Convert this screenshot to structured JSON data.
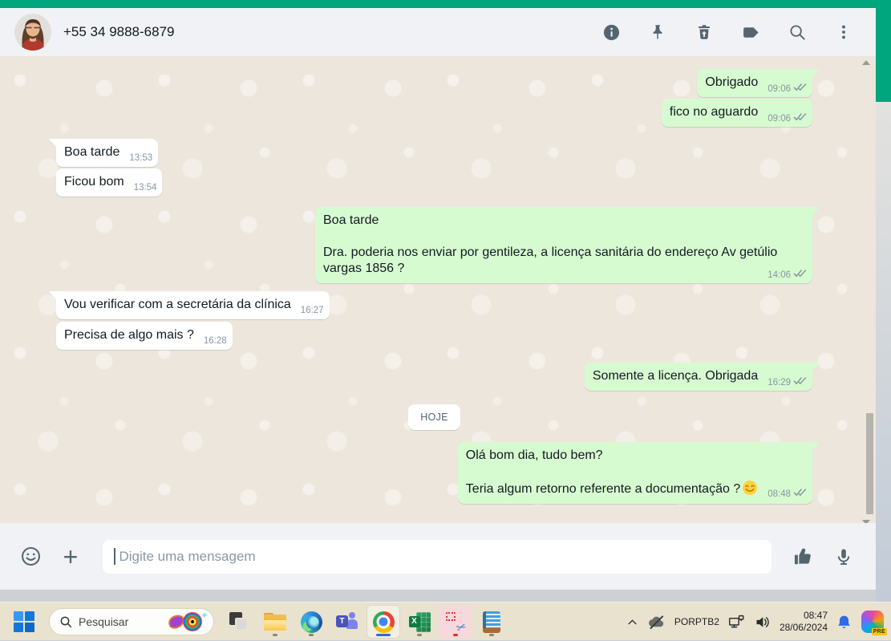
{
  "chat_app": {
    "header": {
      "contact_name": "+55 34 9888-6879",
      "icons": [
        "info-icon",
        "pin-icon",
        "delete-chat-icon",
        "label-icon",
        "search-icon",
        "menu-icon"
      ]
    },
    "messages": [
      {
        "kind": "out",
        "text": "Obrigado",
        "time": "09:06",
        "tail": true,
        "gap": 16
      },
      {
        "kind": "out",
        "text": "fico no aguardo",
        "time": "09:06",
        "gap": 2
      },
      {
        "kind": "in",
        "text": "Boa tarde",
        "time": "13:53",
        "tail": true,
        "gap": 15
      },
      {
        "kind": "in",
        "text": "Ficou bom",
        "time": "13:54",
        "gap": 2
      },
      {
        "kind": "out",
        "text": "Boa tarde\n\nDra. poderia nos enviar por gentileza, a licença sanitária do endereço Av getúlio vargas 1856 ?",
        "time": "14:06",
        "tail": true,
        "gap": 13,
        "wide": true
      },
      {
        "kind": "in",
        "text": "Vou verificar com a secretária da clínica",
        "time": "16:27",
        "tail": true,
        "gap": 10
      },
      {
        "kind": "in",
        "text": "Precisa de algo mais ?",
        "time": "16:28",
        "gap": 3
      },
      {
        "kind": "out",
        "text": "Somente a licença. Obrigada",
        "time": "16:29",
        "tail": true,
        "gap": 16
      },
      {
        "kind": "date",
        "text": "HOJE",
        "gap": 17
      },
      {
        "kind": "out",
        "text": "Olá bom dia, tudo bem?\n\nTeria algum retorno referente a documentação ?",
        "time": "08:48",
        "tail": true,
        "gap": 15,
        "emoji": true
      }
    ],
    "composer": {
      "placeholder": "Digite uma mensagem"
    }
  },
  "taskbar": {
    "search": {
      "placeholder": "Pesquisar"
    },
    "apps": [
      "task-view",
      "file-explorer",
      "edge",
      "teams",
      "chrome",
      "excel",
      "snipping-tool",
      "notepad"
    ],
    "tray": {
      "language_line1": "POR",
      "language_line2": "PTB2",
      "time": "08:47",
      "date": "28/06/2024",
      "copilot_badge": "PRE"
    }
  },
  "colors": {
    "accent_teal": "#00a67e",
    "outgoing_bubble": "#d7fbd0",
    "header_bg": "#f0f2f5",
    "chat_bg": "#ece6dc",
    "taskbar_bg": "#e8e2cf"
  }
}
